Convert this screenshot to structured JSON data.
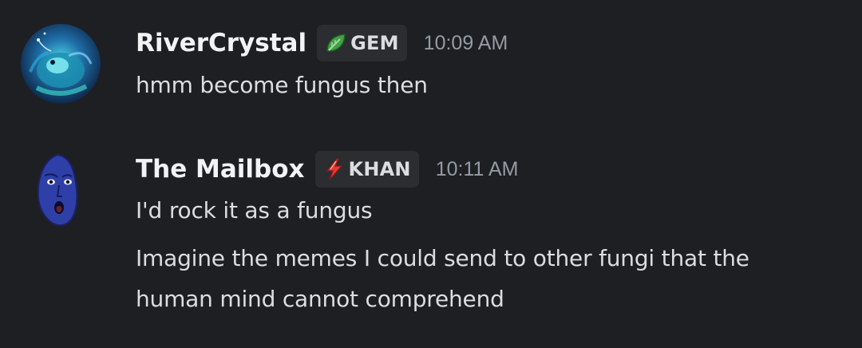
{
  "colors": {
    "background": "#1e1f22",
    "tag_background": "#2b2d31",
    "username": "#f2f3f5",
    "message_text": "#dbdee1",
    "timestamp": "#949ba4",
    "gem_leaf": "#43a047",
    "khan_bolt": "#e53935"
  },
  "messages": [
    {
      "author": "RiverCrystal",
      "avatar_icon": "anglerfish-avatar-icon",
      "tag": {
        "icon": "leaf-icon",
        "label": "GEM"
      },
      "timestamp": "10:09 AM",
      "lines": [
        "hmm become fungus then"
      ]
    },
    {
      "author": "The Mailbox",
      "avatar_icon": "blue-face-avatar-icon",
      "tag": {
        "icon": "lightning-bolt-icon",
        "label": "KHAN"
      },
      "timestamp": "10:11 AM",
      "lines": [
        "I'd rock it as a fungus",
        "Imagine the memes I could send to other fungi that the",
        "human mind cannot comprehend"
      ]
    }
  ]
}
